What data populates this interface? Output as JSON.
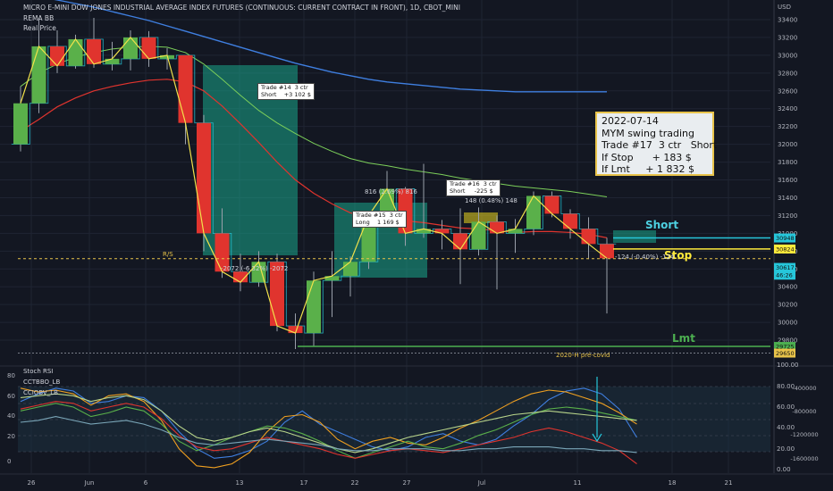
{
  "header": {
    "title": "MICRO E-MINI DOW JONES INDUSTRIAL AVERAGE INDEX FUTURES (CONTINUOUS: CURRENT CONTRACT IN FRONT), 1D, CBOT_MINI",
    "indicator1": "REMA BB",
    "indicator2": "Real Price"
  },
  "price_axis": {
    "currency": "USD",
    "ticks": [
      "33400",
      "33200",
      "33000",
      "32800",
      "32600",
      "32400",
      "32200",
      "32000",
      "31800",
      "31600",
      "31400",
      "31200",
      "31000",
      "30800",
      "30600",
      "30400",
      "30200",
      "30000",
      "29800"
    ]
  },
  "price_tags": [
    {
      "label": "30948",
      "color": "#26c6da",
      "price": 30948
    },
    {
      "label": "30824",
      "color": "#ffeb3b",
      "price": 30824
    },
    {
      "label": "30617",
      "color": "#26c6da",
      "price": 30617
    },
    {
      "label": "46:26",
      "color": "#26c6da",
      "price": 30530
    },
    {
      "label": "29725",
      "color": "#4caf50",
      "price": 29730
    },
    {
      "label": "29650",
      "color": "#e8c34a",
      "price": 29655
    }
  ],
  "info_box": {
    "date": "2022-07-14",
    "line1": "MYM swing trading",
    "line2": "Trade #17  3 ctr   Short",
    "line3": "If Stop      + 183 $",
    "line4": "If Lmt     + 1 832 $"
  },
  "trades": [
    {
      "line1": "Trade #14  3 ctr",
      "line2": "Short    +3 102 $"
    },
    {
      "line1": "Trade #15  3 ctr",
      "line2": "Long    1 169 $"
    },
    {
      "line1": "Trade #16  3 ctr",
      "line2": "Short     -225 $"
    }
  ],
  "signals": {
    "short": "Short",
    "stop": "Stop",
    "lmt": "Lmt"
  },
  "annotations": {
    "covid": "2020-H pré-covid",
    "rs": "R/S",
    "pl14": "-2072 (-6.32%) -2072",
    "pl16a": "816 (2.69%) 816",
    "pl16b": "148 (0.48%) 148",
    "pl17": "-124 (-0.40%) -124"
  },
  "osc": {
    "labels": [
      "Stoch RSI",
      "CCTBBO_LB",
      "CCIOBV_LB"
    ],
    "left_ticks": [
      "80",
      "60",
      "40",
      "20",
      "0"
    ],
    "right_ticks": [
      "100.00",
      "80.00",
      "60.00",
      "40.00",
      "20.00",
      "0.00"
    ],
    "far_ticks": [
      "-400000",
      "-800000",
      "-1200000",
      "-1600000"
    ]
  },
  "time_axis": {
    "labels": [
      "26",
      "Jun",
      "6",
      "13",
      "17",
      "22",
      "27",
      "Jul",
      "11",
      "18",
      "21"
    ]
  },
  "colors": {
    "bg": "#131722",
    "bull": "#5ab04a",
    "bear": "#e0342e",
    "ema_red": "#e0342e",
    "ema_green": "#7ccf5a",
    "ema_blue": "#3f7fe0",
    "ema_orange": "#f0a020",
    "teal": "#19a58a",
    "stop": "#ffeb3b",
    "lmt": "#4caf50"
  },
  "chart_data": {
    "type": "candlestick",
    "title": "MICRO E-MINI DOW JONES INDUSTRIAL AVERAGE INDEX FUTURES (CONTINUOUS: CURRENT CONTRACT IN FRONT), 1D, CBOT_MINI",
    "ylabel": "USD",
    "ylim": [
      29560,
      33520
    ],
    "x_labels": [
      "26",
      "Jun",
      "6",
      "13",
      "17",
      "22",
      "27",
      "Jul",
      "11",
      "18",
      "21"
    ],
    "candles": [
      {
        "o": 32000,
        "h": 32650,
        "l": 31920,
        "c": 32460
      },
      {
        "o": 32460,
        "h": 33420,
        "l": 32350,
        "c": 33100
      },
      {
        "o": 33100,
        "h": 33280,
        "l": 32800,
        "c": 32880
      },
      {
        "o": 32880,
        "h": 33230,
        "l": 32850,
        "c": 33180
      },
      {
        "o": 33180,
        "h": 33420,
        "l": 32860,
        "c": 32900
      },
      {
        "o": 32900,
        "h": 33150,
        "l": 32830,
        "c": 32960
      },
      {
        "o": 32960,
        "h": 33280,
        "l": 32830,
        "c": 33200
      },
      {
        "o": 33200,
        "h": 33270,
        "l": 32870,
        "c": 32960
      },
      {
        "o": 32960,
        "h": 33080,
        "l": 32840,
        "c": 33000
      },
      {
        "o": 33000,
        "h": 32980,
        "l": 32000,
        "c": 32240
      },
      {
        "o": 32240,
        "h": 32330,
        "l": 30800,
        "c": 31000
      },
      {
        "o": 31000,
        "h": 31280,
        "l": 30500,
        "c": 30570
      },
      {
        "o": 30570,
        "h": 30770,
        "l": 30350,
        "c": 30450
      },
      {
        "o": 30450,
        "h": 30800,
        "l": 30400,
        "c": 30680
      },
      {
        "o": 30680,
        "h": 30770,
        "l": 29900,
        "c": 29960
      },
      {
        "o": 29960,
        "h": 30100,
        "l": 29700,
        "c": 29880
      },
      {
        "o": 29880,
        "h": 30570,
        "l": 29730,
        "c": 30470
      },
      {
        "o": 30470,
        "h": 30800,
        "l": 30060,
        "c": 30520
      },
      {
        "o": 30520,
        "h": 30740,
        "l": 30290,
        "c": 30680
      },
      {
        "o": 30680,
        "h": 31250,
        "l": 30600,
        "c": 31200
      },
      {
        "o": 31200,
        "h": 31700,
        "l": 31100,
        "c": 31500
      },
      {
        "o": 31500,
        "h": 31520,
        "l": 30860,
        "c": 31000
      },
      {
        "o": 31000,
        "h": 31780,
        "l": 30950,
        "c": 31050
      },
      {
        "o": 31050,
        "h": 31150,
        "l": 30820,
        "c": 31000
      },
      {
        "o": 31000,
        "h": 31280,
        "l": 30430,
        "c": 30820
      },
      {
        "o": 30820,
        "h": 31290,
        "l": 30750,
        "c": 31130
      },
      {
        "o": 31130,
        "h": 31200,
        "l": 30370,
        "c": 31000
      },
      {
        "o": 31000,
        "h": 31160,
        "l": 30780,
        "c": 31050
      },
      {
        "o": 31050,
        "h": 31470,
        "l": 30980,
        "c": 31420
      },
      {
        "o": 31420,
        "h": 31470,
        "l": 31180,
        "c": 31220
      },
      {
        "o": 31220,
        "h": 31270,
        "l": 30940,
        "c": 31050
      },
      {
        "o": 31050,
        "h": 31180,
        "l": 30710,
        "c": 30880
      },
      {
        "o": 30880,
        "h": 30950,
        "l": 30100,
        "c": 30720
      }
    ],
    "levels": {
      "short_entry": 30948,
      "stop": 30824,
      "lmt": 29730,
      "pre_covid": 29655,
      "rs": 30715
    },
    "series": [
      {
        "name": "EMA red",
        "values": [
          32150,
          32280,
          32420,
          32520,
          32600,
          32650,
          32690,
          32720,
          32730,
          32700,
          32600,
          32430,
          32230,
          32020,
          31800,
          31600,
          31450,
          31330,
          31230,
          31180,
          31170,
          31140,
          31120,
          31090,
          31060,
          31050,
          31030,
          31010,
          31020,
          31020,
          31010,
          30990,
          30950
        ]
      },
      {
        "name": "EMA green",
        "values": [
          32650,
          32800,
          32900,
          32980,
          33030,
          33070,
          33090,
          33100,
          33090,
          33030,
          32900,
          32730,
          32550,
          32380,
          32240,
          32120,
          32010,
          31920,
          31840,
          31790,
          31760,
          31720,
          31690,
          31660,
          31620,
          31590,
          31560,
          31530,
          31510,
          31490,
          31470,
          31440,
          31410
        ]
      },
      {
        "name": "EMA blue",
        "values": [
          33700,
          33660,
          33620,
          33580,
          33540,
          33490,
          33440,
          33390,
          33330,
          33270,
          33210,
          33150,
          33090,
          33030,
          32970,
          32910,
          32860,
          32810,
          32770,
          32730,
          32700,
          32680,
          32660,
          32640,
          32620,
          32610,
          32600,
          32590,
          32590,
          32590,
          32590,
          32590,
          32590
        ]
      }
    ]
  }
}
